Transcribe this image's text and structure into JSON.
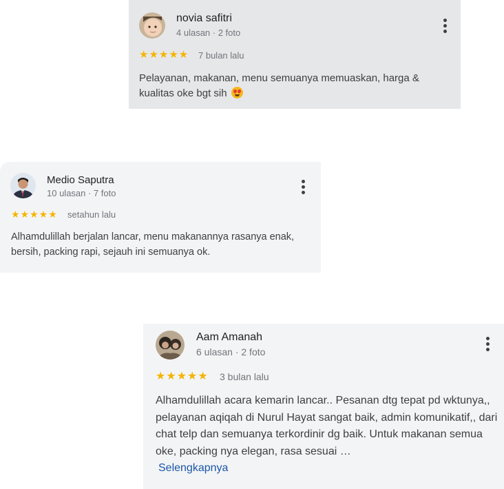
{
  "reviews": [
    {
      "name": "novia safitri",
      "meta": "4 ulasan · 2 foto",
      "stars": "★★★★★",
      "rating": 5,
      "when": "7 bulan lalu",
      "text": "Pelayanan, makanan, menu semuanya memuaskan, harga & kualitas oke bgt sih",
      "emoji_icon": "heart-eyes-emoji"
    },
    {
      "name": "Medio Saputra",
      "meta": "10 ulasan · 7 foto",
      "stars": "★★★★★",
      "rating": 5,
      "when": "setahun lalu",
      "text": "Alhamdulillah berjalan lancar, menu makanannya rasanya enak, bersih, packing rapi, sejauh ini semuanya ok."
    },
    {
      "name": "Aam Amanah",
      "meta": "6 ulasan · 2 foto",
      "stars": "★★★★★",
      "rating": 5,
      "when": "3 bulan lalu",
      "text": "Alhamdulillah acara kemarin lancar.. Pesanan dtg tepat pd wktunya,, pelayanan aqiqah di Nurul Hayat sangat baik, admin komunikatif,, dari chat telp dan semuanya terkordinir dg baik. Untuk makanan semua oke, packing nya elegan, rasa sesuai …",
      "more_link": "Selengkapnya"
    }
  ],
  "colors": {
    "star": "#f4b400",
    "link": "#1a56a7",
    "card_bg": "#f3f4f6"
  }
}
